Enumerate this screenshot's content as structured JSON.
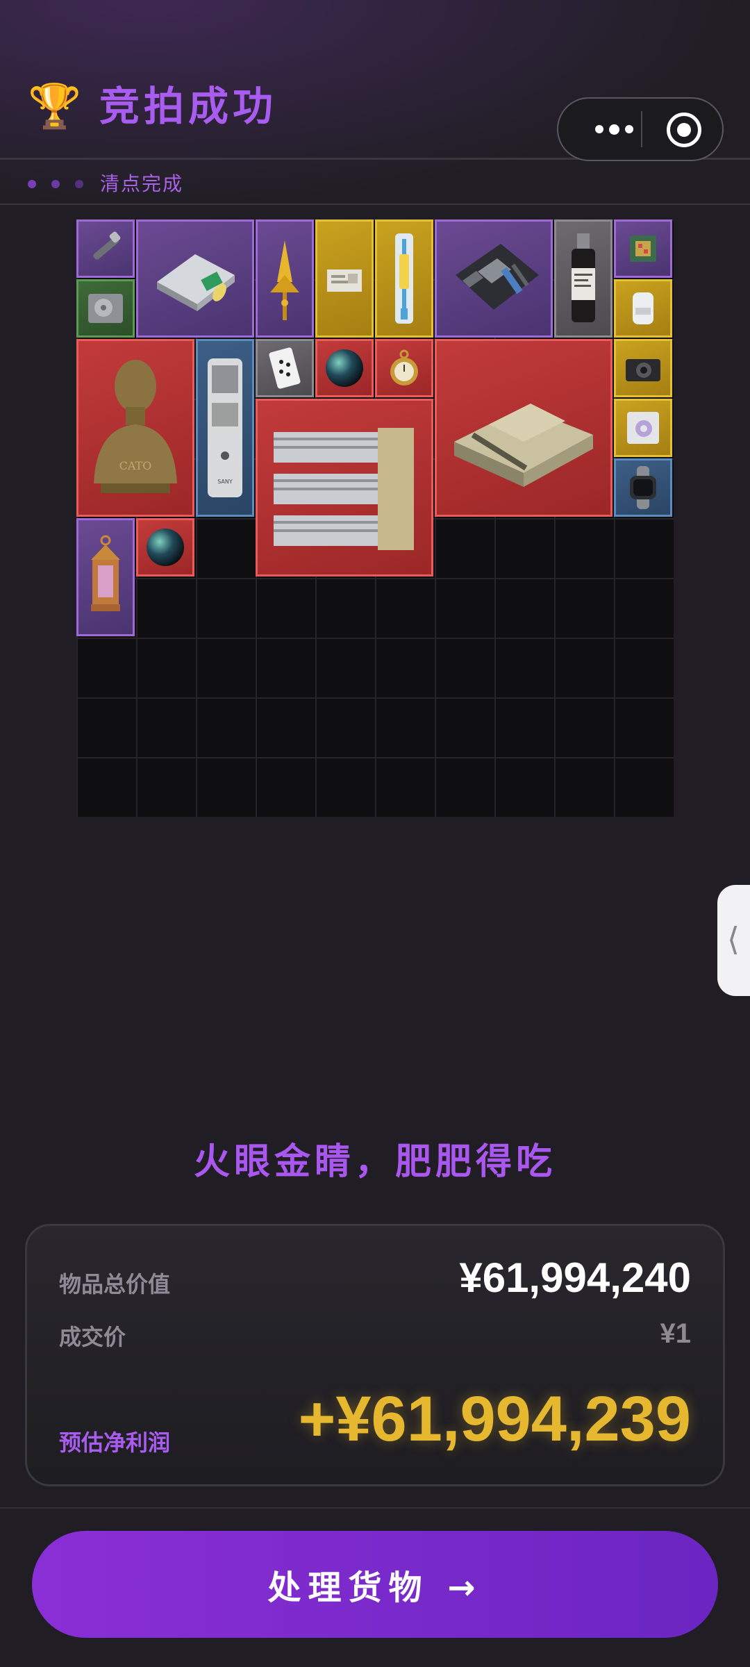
{
  "header": {
    "icon": "trophy-icon",
    "title": "竞拍成功"
  },
  "capsule": {
    "more_icon": "more-dots-icon",
    "close_icon": "target-circle-icon"
  },
  "subbar": {
    "status": "清点完成",
    "dot_colors": [
      "#7a3fb8",
      "#6a3aa0",
      "#533080"
    ]
  },
  "inventory": {
    "items": [
      {
        "name": "flashlight",
        "rarity": "purple"
      },
      {
        "name": "hard-drive",
        "rarity": "green"
      },
      {
        "name": "game-console",
        "rarity": "purple"
      },
      {
        "name": "golden-ornament",
        "rarity": "purple"
      },
      {
        "name": "document-card",
        "rarity": "gold"
      },
      {
        "name": "syringe-kit",
        "rarity": "gold"
      },
      {
        "name": "motherboard",
        "rarity": "purple"
      },
      {
        "name": "medicine-bottle",
        "rarity": "grey"
      },
      {
        "name": "chip",
        "rarity": "purple"
      },
      {
        "name": "device-module",
        "rarity": "gold"
      },
      {
        "name": "bronze-bust",
        "rarity": "red"
      },
      {
        "name": "radio-device",
        "rarity": "blue"
      },
      {
        "name": "playing-card",
        "rarity": "grey"
      },
      {
        "name": "glass-orb",
        "rarity": "red"
      },
      {
        "name": "pocket-watch",
        "rarity": "red"
      },
      {
        "name": "battle-tank",
        "rarity": "red"
      },
      {
        "name": "camera",
        "rarity": "gold"
      },
      {
        "name": "processor-module",
        "rarity": "gold"
      },
      {
        "name": "smart-watch",
        "rarity": "blue"
      },
      {
        "name": "server-rack",
        "rarity": "red"
      },
      {
        "name": "lantern",
        "rarity": "purple"
      },
      {
        "name": "glass-orb-2",
        "rarity": "red"
      }
    ],
    "bust_caption": "CATO",
    "radio_brand": "SANY"
  },
  "side_handle": {
    "icon": "chevron-left-icon"
  },
  "slogan": "火眼金睛，肥肥得吃",
  "summary": {
    "total_value_label": "物品总价值",
    "total_value": "¥61,994,240",
    "deal_price_label": "成交价",
    "deal_price": "¥1",
    "net_profit_label": "预估净利润",
    "net_profit": "+¥61,994,239"
  },
  "action_button": {
    "label": "处理货物 →"
  },
  "colors": {
    "accent": "#a95cf0",
    "profit": "#e6b830",
    "button": "#7b2ccd"
  }
}
